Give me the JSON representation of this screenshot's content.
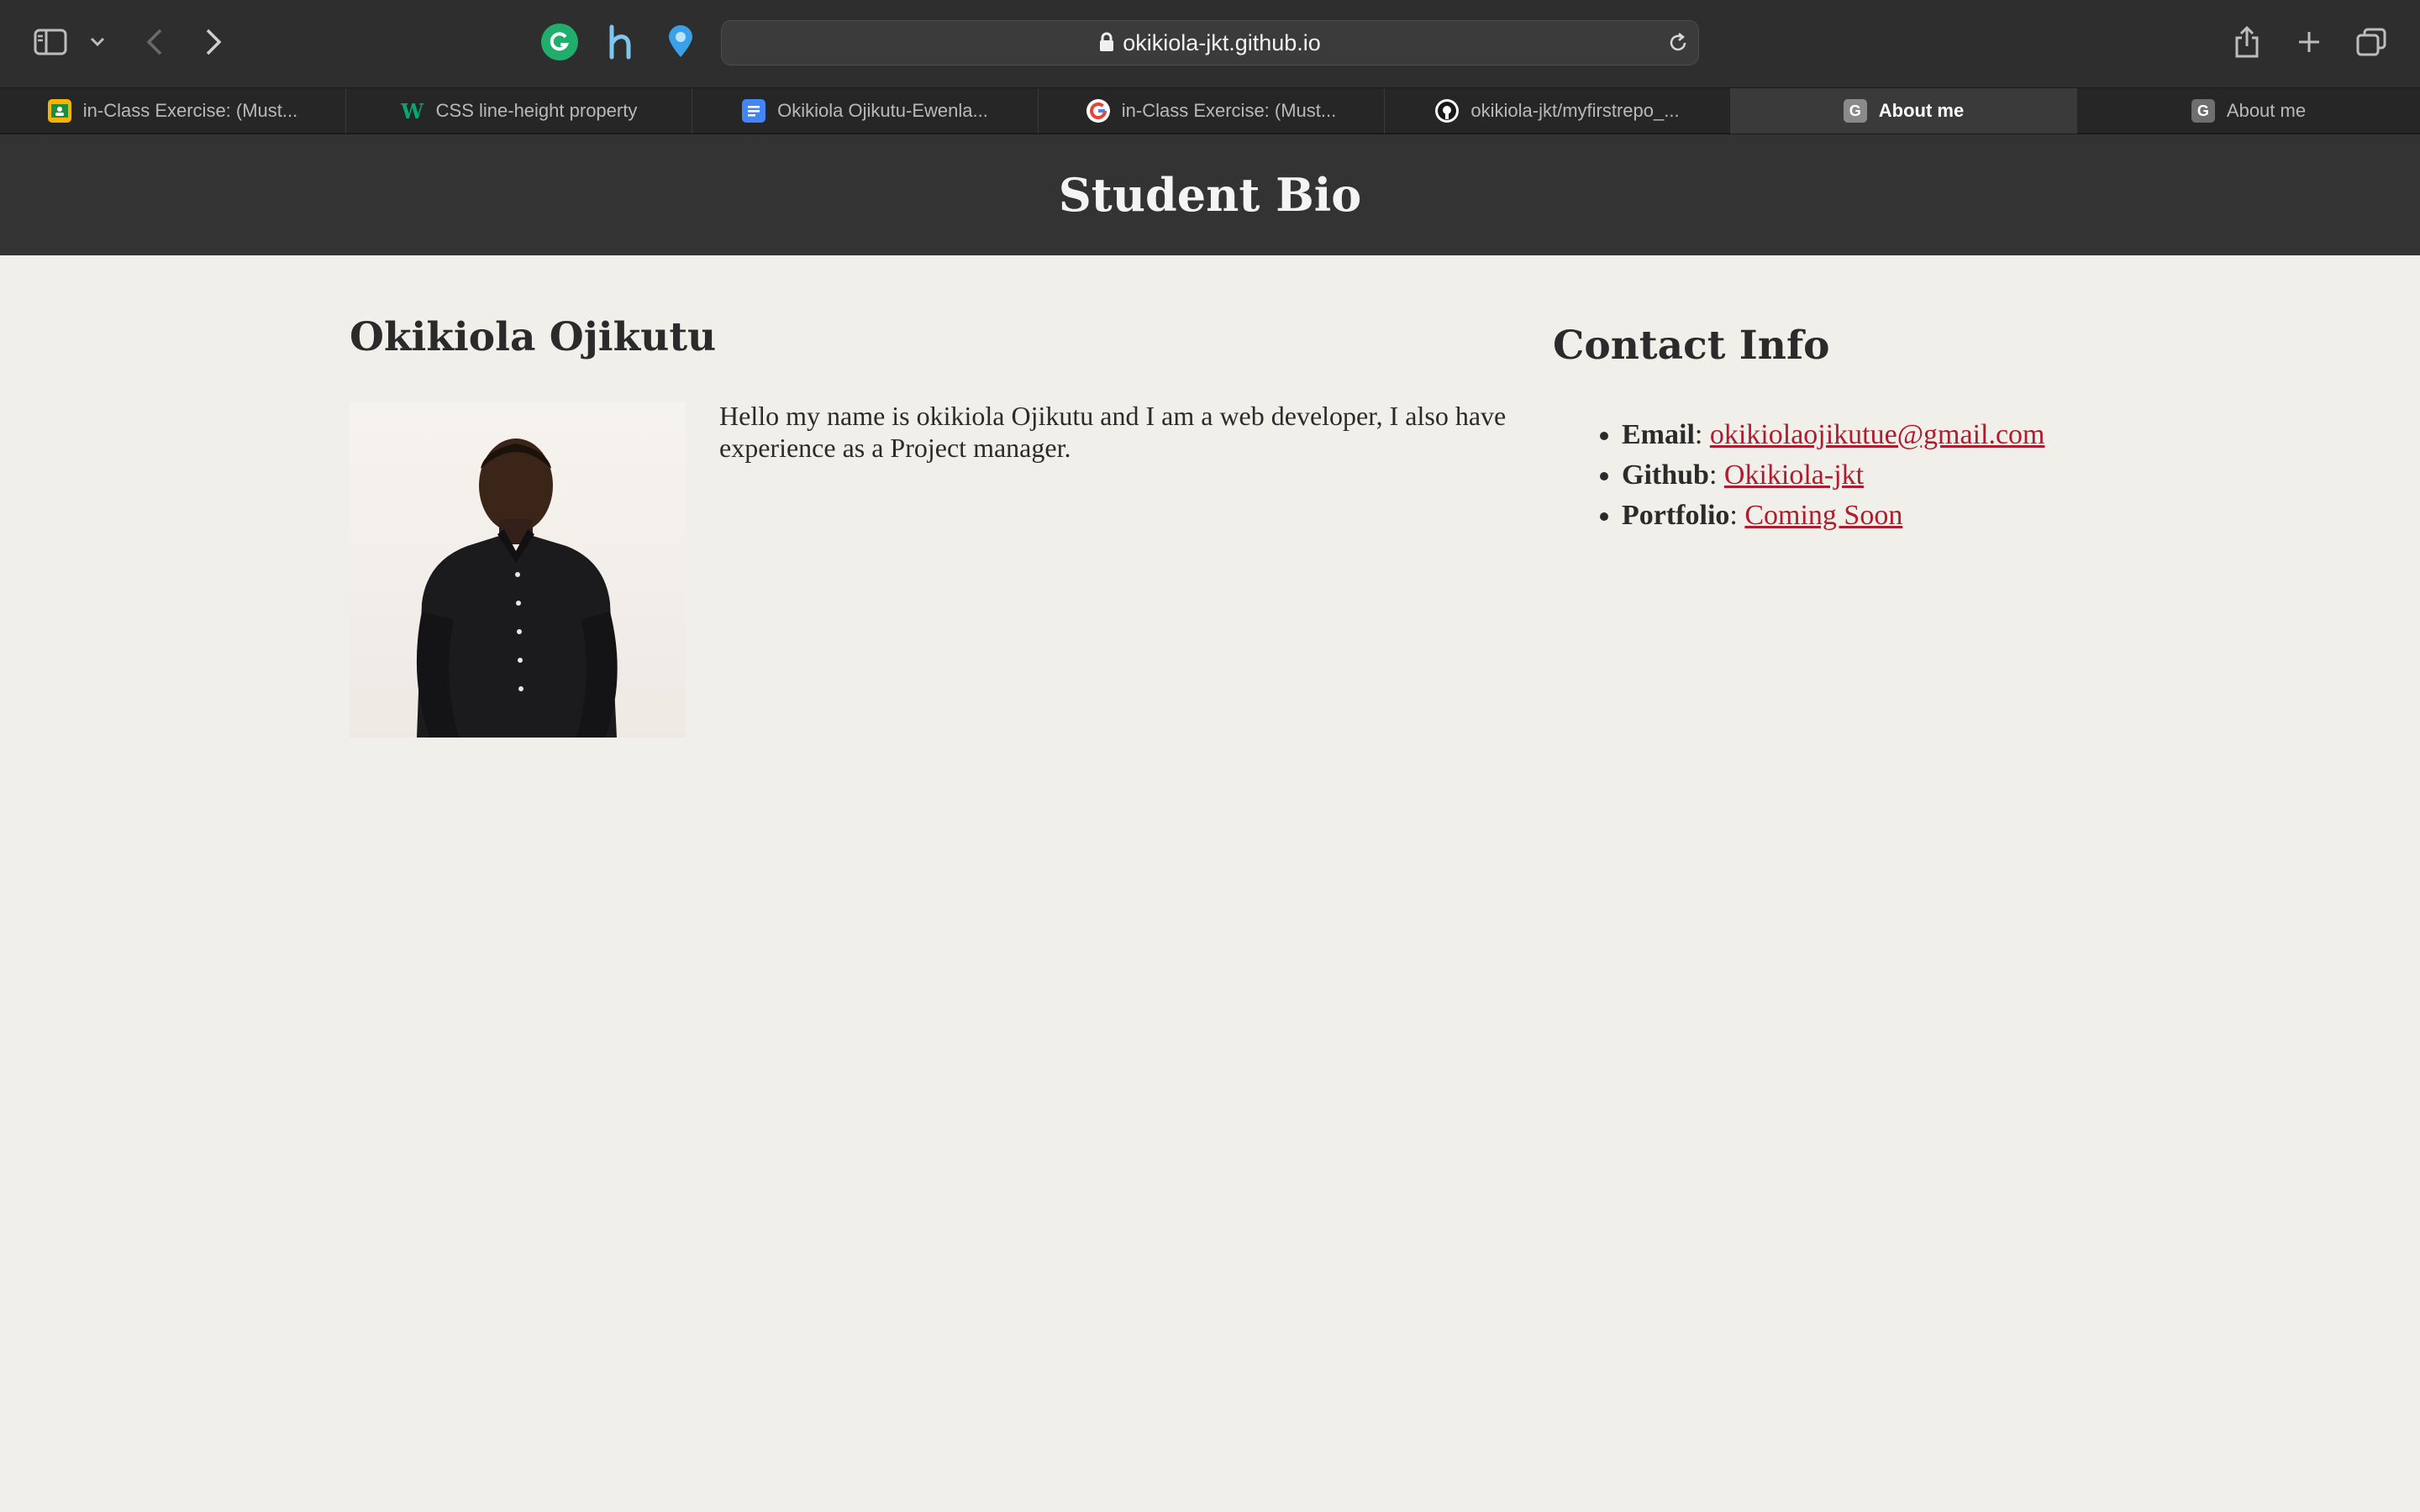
{
  "browser": {
    "url": "okikiola-jkt.github.io",
    "tabs": [
      {
        "title": "in-Class Exercise: (Must...",
        "favicon": "classroom-icon",
        "active": false
      },
      {
        "title": "CSS line-height property",
        "favicon": "w3schools-icon",
        "active": false
      },
      {
        "title": "Okikiola Ojikutu-Ewenla...",
        "favicon": "google-docs-icon",
        "active": false
      },
      {
        "title": "in-Class Exercise: (Must...",
        "favicon": "google-icon",
        "active": false
      },
      {
        "title": "okikiola-jkt/myfirstrepo_...",
        "favicon": "github-icon",
        "active": false
      },
      {
        "title": "About me",
        "favicon": "g-letter-icon",
        "active": true
      },
      {
        "title": "About me",
        "favicon": "g-letter-icon",
        "active": false
      }
    ],
    "favicon_letter": "G"
  },
  "page": {
    "site_title": "Student Bio",
    "name": "Okikiola Ojikutu",
    "bio": "Hello my name is okikiola Ojikutu and I am a web developer, I also have experience as a Project manager.",
    "contact": {
      "title": "Contact Info",
      "items": [
        {
          "label": "Email",
          "separator": ":",
          "value": "okikiolaojikutue@gmail.com"
        },
        {
          "label": "Github",
          "separator": ":",
          "value": "Okikiola-jkt"
        },
        {
          "label": "Portfolio",
          "separator": ":",
          "value": "Coming Soon"
        }
      ]
    }
  },
  "colors": {
    "header_bg": "#333333",
    "page_bg": "#f1efea",
    "link": "#b01c2e"
  }
}
